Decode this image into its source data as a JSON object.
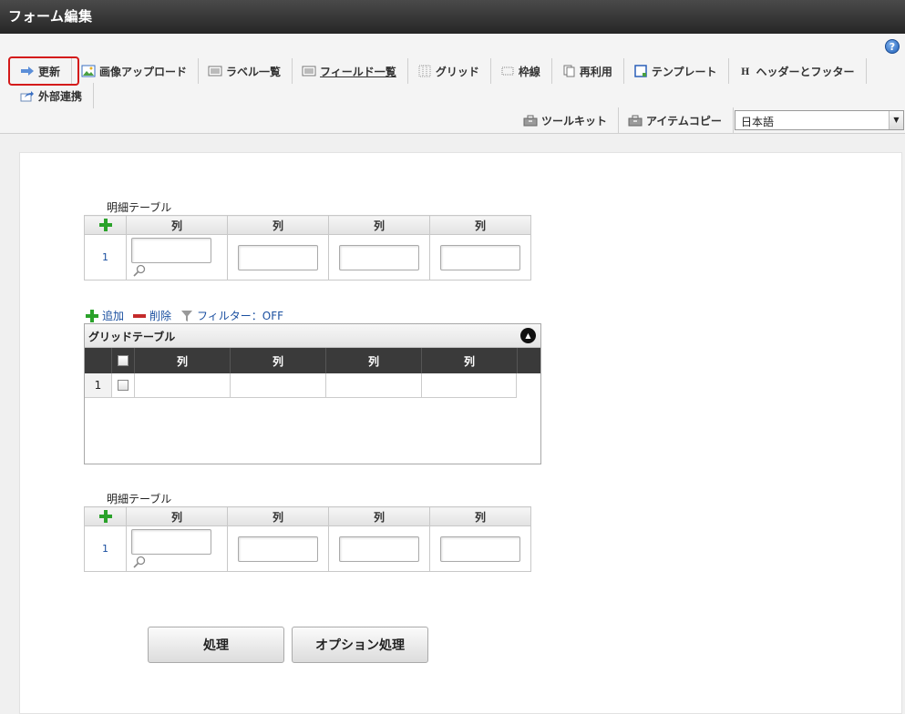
{
  "window": {
    "title": "フォーム編集",
    "help_glyph": "?"
  },
  "toolbar": {
    "row1": [
      {
        "name": "update-button",
        "icon": "update-icon",
        "label": "更新"
      },
      {
        "name": "image-upload-button",
        "icon": "image-icon",
        "label": "画像アップロード"
      },
      {
        "name": "label-list-button",
        "icon": "list-icon",
        "label": "ラベル一覧"
      },
      {
        "name": "field-list-button",
        "icon": "list-icon",
        "label": "フィールド一覧"
      },
      {
        "name": "grid-button",
        "icon": "grid-icon",
        "label": "グリッド"
      },
      {
        "name": "border-button",
        "icon": "border-icon",
        "label": "枠線"
      },
      {
        "name": "reuse-button",
        "icon": "copy-icon",
        "label": "再利用"
      },
      {
        "name": "template-button",
        "icon": "template-icon",
        "label": "テンプレート"
      },
      {
        "name": "header-footer-button",
        "icon": "header-icon",
        "label": "ヘッダーとフッター"
      }
    ],
    "row2": [
      {
        "name": "external-link-button",
        "icon": "share-icon",
        "label": "外部連携"
      }
    ],
    "row3": [
      {
        "name": "toolkit-button",
        "icon": "toolbox-icon",
        "label": "ツールキット"
      },
      {
        "name": "item-copy-button",
        "icon": "toolbox-icon",
        "label": "アイテムコピー"
      }
    ],
    "language": "日本語"
  },
  "detail_table_1": {
    "caption": "明細テーブル",
    "columns": [
      "列",
      "列",
      "列",
      "列"
    ],
    "row_number": "1"
  },
  "grid_actions": {
    "add": "追加",
    "delete": "削除",
    "filter": "フィルター：OFF"
  },
  "grid_table": {
    "title": "グリッドテーブル",
    "columns": [
      "列",
      "列",
      "列",
      "列"
    ],
    "row_number": "1"
  },
  "detail_table_2": {
    "caption": "明細テーブル",
    "columns": [
      "列",
      "列",
      "列",
      "列"
    ],
    "row_number": "1"
  },
  "buttons": {
    "process": "処理",
    "option_process": "オプション処理"
  }
}
